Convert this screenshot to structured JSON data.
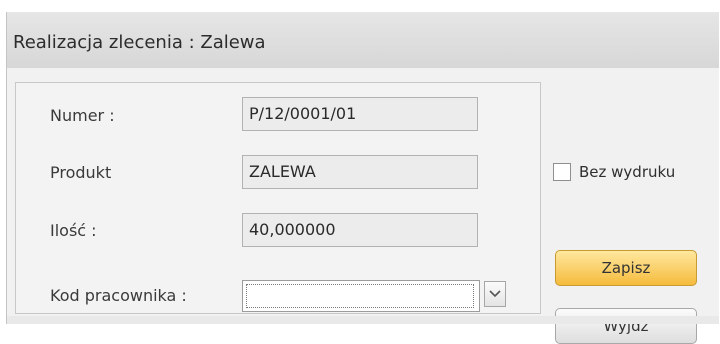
{
  "window": {
    "title": "Realizacja zlecenia : Zalewa"
  },
  "form": {
    "fields": [
      {
        "label": "Numer :",
        "value": "P/12/0001/01"
      },
      {
        "label": "Produkt",
        "value": "ZALEWA"
      },
      {
        "label": "Ilość :",
        "value": "40,000000"
      }
    ],
    "employee_code": {
      "label": "Kod pracownika :",
      "value": ""
    }
  },
  "options": {
    "no_print_label": "Bez wydruku",
    "no_print_checked": false
  },
  "actions": {
    "save_label": "Zapisz",
    "exit_label": "Wyjdź"
  },
  "icons": {
    "dropdown": "chevron-down-icon"
  }
}
